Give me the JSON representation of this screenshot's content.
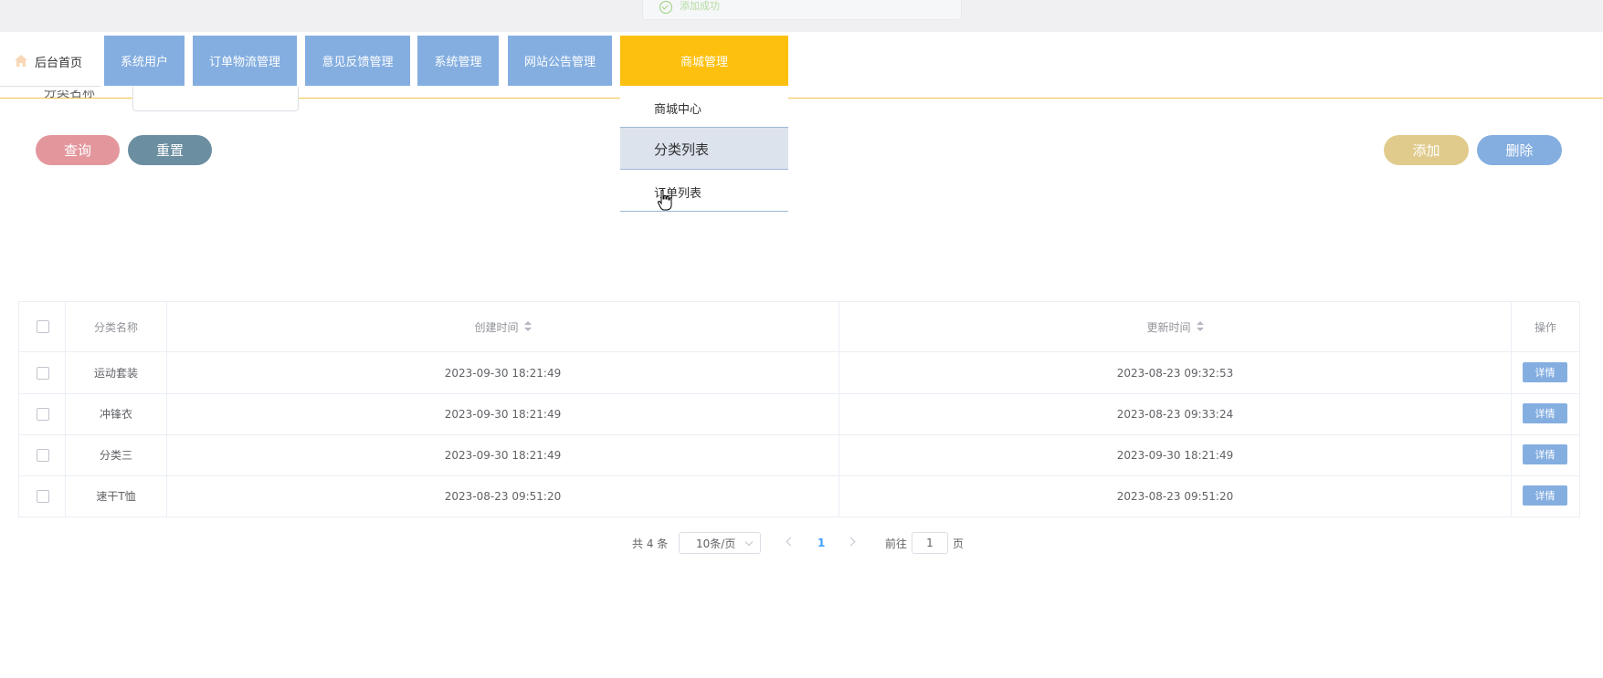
{
  "toast": {
    "text": "添加成功"
  },
  "nav": {
    "home": "后台首页",
    "items": [
      "系统用户",
      "订单物流管理",
      "意见反馈管理",
      "系统管理",
      "网站公告管理",
      "商城管理"
    ]
  },
  "dropdown": {
    "items": [
      "商城中心",
      "分类列表",
      "订单列表"
    ]
  },
  "search": {
    "label": "分类名称"
  },
  "buttons": {
    "query": "查询",
    "reset": "重置",
    "add": "添加",
    "delete": "删除"
  },
  "colors": {
    "nav": "#84aee0",
    "nav_active": "#fdc00f",
    "query": "#e3979d",
    "reset": "#6b8ea1",
    "add": "#e0cb8c",
    "delete": "#84aee0"
  },
  "table": {
    "headers": {
      "name": "分类名称",
      "created": "创建时间",
      "updated": "更新时间",
      "action": "操作"
    },
    "rows": [
      {
        "name": "运动套装",
        "created": "2023-09-30 18:21:49",
        "updated": "2023-08-23 09:32:53",
        "action": "详情"
      },
      {
        "name": "冲锋衣",
        "created": "2023-09-30 18:21:49",
        "updated": "2023-08-23 09:33:24",
        "action": "详情"
      },
      {
        "name": "分类三",
        "created": "2023-09-30 18:21:49",
        "updated": "2023-09-30 18:21:49",
        "action": "详情"
      },
      {
        "name": "速干T恤",
        "created": "2023-08-23 09:51:20",
        "updated": "2023-08-23 09:51:20",
        "action": "详情"
      }
    ]
  },
  "pagination": {
    "total": "共 4 条",
    "page_size": "10条/页",
    "current": "1",
    "goto_label": "前往",
    "goto_value": "1",
    "page_unit": "页"
  }
}
